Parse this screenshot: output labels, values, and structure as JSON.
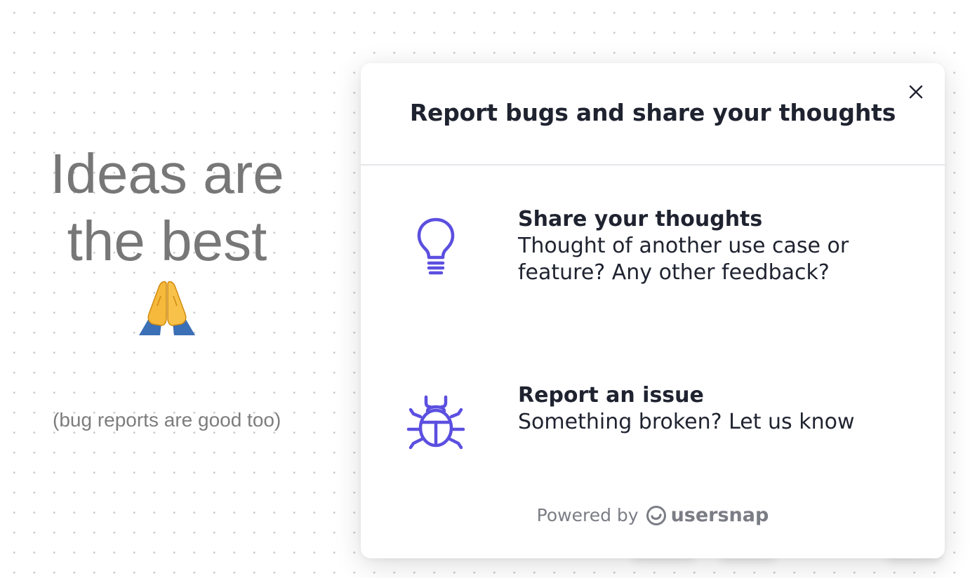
{
  "page": {
    "headline_line1": "Ideas are",
    "headline_line2": "the best",
    "emoji_icon": "folded-hands-icon",
    "subnote": "(bug reports are good too)"
  },
  "modal": {
    "title": "Report bugs and share your thoughts",
    "close_icon": "close-icon",
    "options": [
      {
        "icon": "lightbulb-icon",
        "title": "Share your thoughts",
        "description_line1": "Thought of another use case or",
        "description_line2": "feature? Any other feedback?"
      },
      {
        "icon": "bug-icon",
        "title": "Report an issue",
        "description_line1": "Something broken? Let us know",
        "description_line2": ""
      }
    ],
    "footer": {
      "powered_by": "Powered by",
      "brand_icon": "usersnap-logo-icon",
      "brand_name": "usersnap"
    }
  },
  "colors": {
    "accent": "#5b4fe0",
    "title_text": "#1f2330",
    "muted_text": "#7b7d85",
    "left_text": "#777777"
  }
}
